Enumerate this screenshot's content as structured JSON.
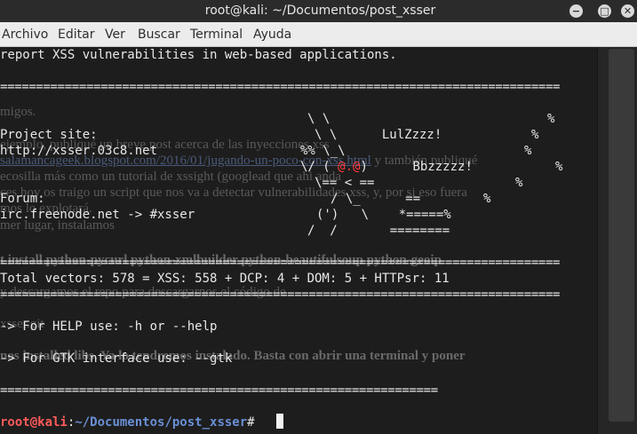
{
  "window": {
    "title": "root@kali: ~/Documentos/post_xsser",
    "minimize_glyph": "−",
    "maximize_glyph": "□",
    "close_glyph": "✕"
  },
  "menu": [
    "Archivo",
    "Editar",
    "Ver",
    "Buscar",
    "Terminal",
    "Ayuda"
  ],
  "terminal": {
    "lines": {
      "l0": "report XSS vulnerabilities in web-based applications.",
      "sep1": "==============================================================================",
      "l_project": "Project site:",
      "l_url": "http://xsser.03c8.net",
      "l_forum": "Forum:",
      "l_irc": "irc.freenode.net -> #xsser",
      "sep2": "==============================================================================",
      "l_vectors": "Total vectors: 578 = XSS: 558 + DCP: 4 + DOM: 5 + HTTPsr: 11",
      "sep3": "==============================================================================",
      "l_help": "-> For HELP use: -h or --help",
      "l_gtk": "-> For GTK interface use: --gtk",
      "sep4": "============================================================="
    },
    "art": {
      "a1": "\\ \\",
      "a2": "\\ \\      LulZzzz!",
      "a3": "%% \\_\\",
      "a4_pre": "\\/ ( ",
      "a4_eyes": "@.@",
      "a4_post": ")      Bbzzzzz!",
      "a5": "\\== < ==",
      "a6": "/ \\_      ==",
      "a7": "(')   \\    *=====%",
      "a8": "/  /       ========",
      "p1": "%",
      "p2": "%",
      "p3": "%",
      "p4": "%",
      "p5": "%",
      "p6": "%"
    },
    "prompt": {
      "user": "root@kali",
      "sep": ":",
      "path": "~/Documentos/post_xsser",
      "symbol": "# "
    }
  },
  "background_page": {
    "g1": "migos.",
    "g2": "ejemplo, publiqué un breve post acerca de las inyecciones xss",
    "g3_link": "salamancageek.blogspot.com/2016/01/jugando-un-poco-con-xss.html",
    "g3_after": "y también publiqué",
    "g4": "ecosilla más como un tutorial de xssight (googlead que ahi anda",
    "g5": "ces hoy os traigo un script que nos va a detectar vulnerabilidades xss, y, por si eso fuera",
    "g6": "mos lo explotará.",
    "g7": "mer lugar, instalamos",
    "g8": "t install python-pycurl python-xmlbuilder python-beautifulsoup python-geoip",
    "g9": "y descargamos el repo para descargarnos el código de",
    "g10": "xsser.git",
    "g11": "nos installed libs. Ya lo tendremos instalado. Basta con abrir una terminal y poner"
  }
}
